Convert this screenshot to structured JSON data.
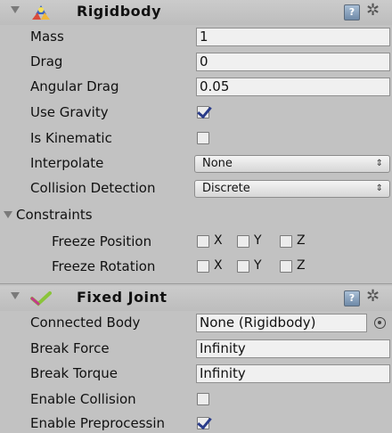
{
  "rigidbody": {
    "title": "Rigidbody",
    "icons": {
      "component": "rigidbody-icon",
      "help": "help-book-icon",
      "settings": "gear-icon"
    },
    "help_glyph": "?",
    "mass": {
      "label": "Mass",
      "value": "1"
    },
    "drag": {
      "label": "Drag",
      "value": "0"
    },
    "angular_drag": {
      "label": "Angular Drag",
      "value": "0.05"
    },
    "use_gravity": {
      "label": "Use Gravity",
      "checked": true
    },
    "is_kinematic": {
      "label": "Is Kinematic",
      "checked": false
    },
    "interpolate": {
      "label": "Interpolate",
      "value": "None"
    },
    "collision_detection": {
      "label": "Collision Detection",
      "value": "Discrete"
    },
    "constraints": {
      "label": "Constraints",
      "freeze_position": {
        "label": "Freeze Position",
        "axes": [
          "X",
          "Y",
          "Z"
        ]
      },
      "freeze_rotation": {
        "label": "Freeze Rotation",
        "axes": [
          "X",
          "Y",
          "Z"
        ]
      }
    }
  },
  "fixed_joint": {
    "title": "Fixed Joint",
    "icons": {
      "component": "joint-checkmark-icon",
      "help": "help-book-icon",
      "settings": "gear-icon"
    },
    "help_glyph": "?",
    "connected_body": {
      "label": "Connected Body",
      "value": "None (Rigidbody)"
    },
    "break_force": {
      "label": "Break Force",
      "value": "Infinity"
    },
    "break_torque": {
      "label": "Break Torque",
      "value": "Infinity"
    },
    "enable_collision": {
      "label": "Enable Collision",
      "checked": false
    },
    "enable_preprocessing": {
      "label": "Enable Preprocessin",
      "checked": true
    }
  },
  "glyphs": {
    "dropdown_arrow": "⇕",
    "gear": "✲"
  }
}
